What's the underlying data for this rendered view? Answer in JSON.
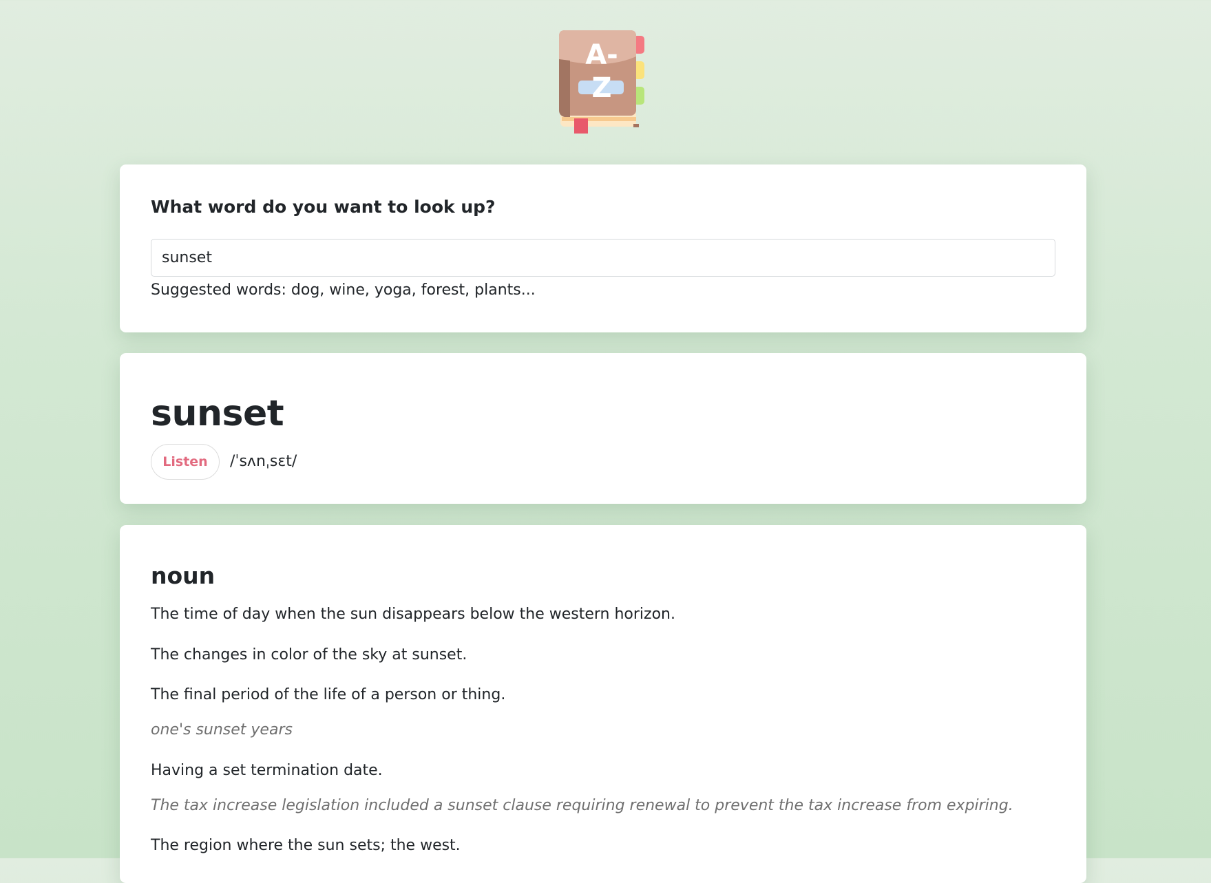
{
  "app": {
    "logo_icon": "dictionary-book-icon",
    "logo_text": "A-Z"
  },
  "search": {
    "question": "What word do you want to look up?",
    "value": "sunset",
    "suggested": "Suggested words: dog, wine, yoga, forest, plants..."
  },
  "word": {
    "title": "sunset",
    "listen_label": "Listen",
    "phonetic": "/ˈsʌnˌsɛt/"
  },
  "meaning": {
    "part_of_speech": "noun",
    "definitions": [
      {
        "text": "The time of day when the sun disappears below the western horizon."
      },
      {
        "text": "The changes in color of the sky at sunset."
      },
      {
        "text": "The final period of the life of a person or thing.",
        "example": "one's sunset years"
      },
      {
        "text": "Having a set termination date.",
        "example": "The tax increase legislation included a sunset clause requiring renewal to prevent the tax increase from expiring."
      },
      {
        "text": "The region where the sun sets; the west."
      }
    ]
  },
  "colors": {
    "accent": "#e26a7f",
    "background": "#d3e8d3",
    "card": "#ffffff",
    "text": "#212529",
    "example_text": "#6f6f6f"
  }
}
